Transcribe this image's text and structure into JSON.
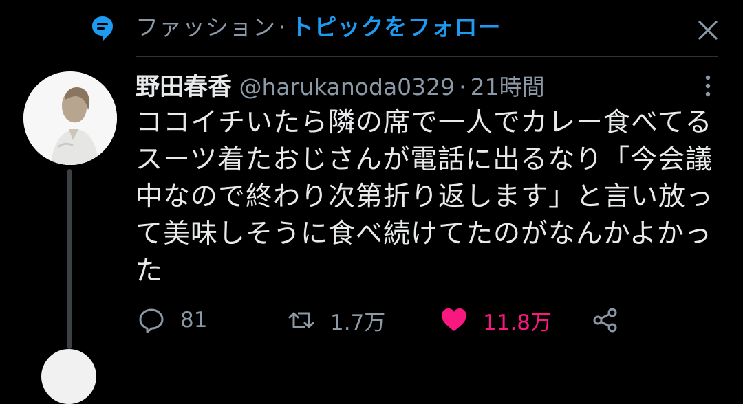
{
  "topic": {
    "name": "ファッション",
    "dot": "·",
    "follow_label": "トピックをフォロー"
  },
  "tweet": {
    "author_name": "野田春香",
    "handle": "@harukanoda0329",
    "separator": "·",
    "time": "21時間",
    "text": "ココイチいたら隣の席で一人でカレー食べてる\nスーツ着たおじさんが電話に出るなり「今会議\n中なので終わり次第折り返します」と言い放っ\nて美味しそうに食べ続けてたのがなんかよかっ\nた",
    "replies": "81",
    "retweets": "1.7万",
    "likes": "11.8万"
  },
  "colors": {
    "accent": "#1d9bf0",
    "like": "#f91880",
    "muted": "#8b98a5",
    "text": "#e7e9ea",
    "background": "#000000"
  },
  "icons": {
    "topic": "topic-bubble-icon",
    "close": "close-icon",
    "more": "more-vertical-icon",
    "reply": "reply-icon",
    "retweet": "retweet-icon",
    "like": "heart-filled-icon",
    "share": "share-icon"
  }
}
